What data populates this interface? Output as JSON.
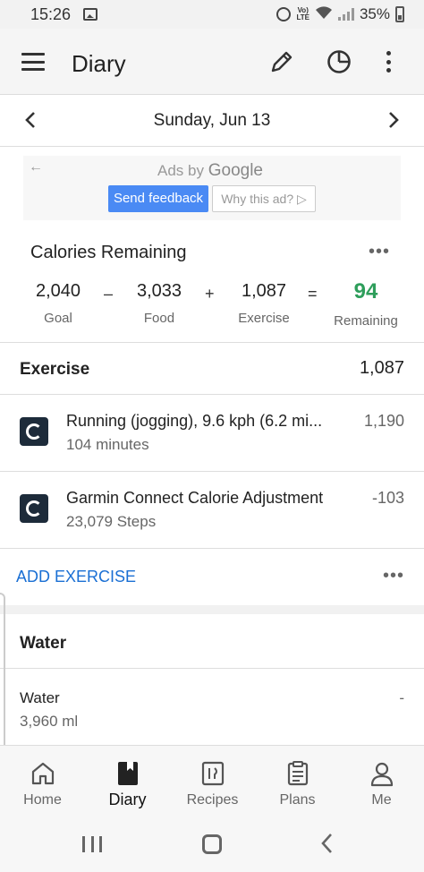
{
  "status_bar": {
    "time": "15:26",
    "battery": "35%",
    "lte": "Vo) LTE"
  },
  "app_bar": {
    "title": "Diary"
  },
  "date_nav": {
    "date": "Sunday, Jun 13",
    "prev": "‹",
    "next": "›"
  },
  "ad": {
    "ads_by": "Ads by",
    "google": "Google",
    "feedback": "Send feedback",
    "why": "Why this ad? ▷",
    "back": "←"
  },
  "calories": {
    "title": "Calories Remaining",
    "goal_value": "2,040",
    "goal_label": "Goal",
    "op1": "–",
    "food_value": "3,033",
    "food_label": "Food",
    "op2": "+",
    "exercise_value": "1,087",
    "exercise_label": "Exercise",
    "op3": "=",
    "remaining_value": "94",
    "remaining_label": "Remaining",
    "remaining_color": "#2e9e5b"
  },
  "exercise": {
    "title": "Exercise",
    "total": "1,087",
    "entries": [
      {
        "name": "Running (jogging), 9.6 kph (6.2 mi...",
        "sub": "104 minutes",
        "cal": "1,190"
      },
      {
        "name": "Garmin Connect Calorie Adjustment",
        "sub": "23,079 Steps",
        "cal": "-103"
      }
    ],
    "add_label": "ADD EXERCISE"
  },
  "water": {
    "title": "Water",
    "entry_name": "Water",
    "entry_sub": "3,960 ml",
    "entry_cal": "-"
  },
  "bottom_nav": {
    "items": [
      {
        "label": "Home",
        "icon": "home-icon"
      },
      {
        "label": "Diary",
        "icon": "diary-icon"
      },
      {
        "label": "Recipes",
        "icon": "recipes-icon"
      },
      {
        "label": "Plans",
        "icon": "plans-icon"
      },
      {
        "label": "Me",
        "icon": "person-icon"
      }
    ],
    "active": "Diary"
  },
  "more_glyph": "•••"
}
